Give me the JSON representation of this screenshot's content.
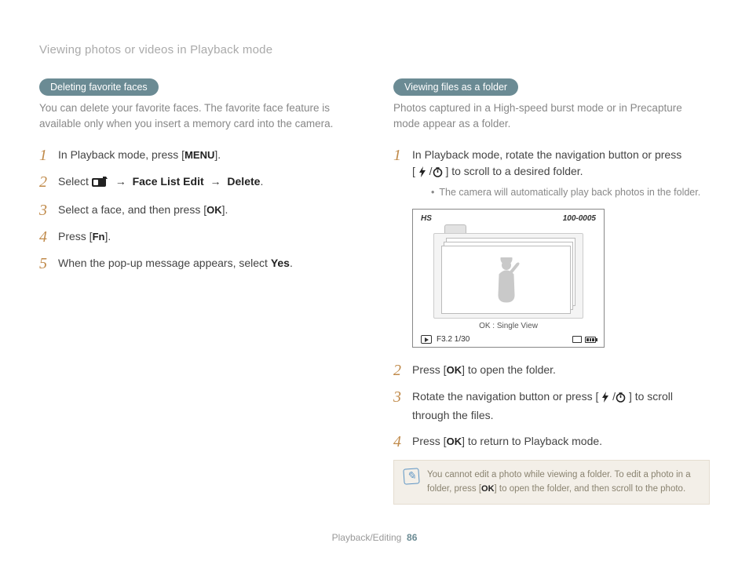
{
  "breadcrumb": "Viewing photos or videos in Playback mode",
  "left": {
    "pill": "Deleting favorite faces",
    "lead": "You can delete your favorite faces. The favorite face feature is available only when you insert a memory card into the camera.",
    "steps": [
      {
        "num": "1",
        "pre": "In Playback mode, press [",
        "btn": "MENU",
        "post": "]."
      },
      {
        "num": "2",
        "pre": "Select ",
        "path1": "Face List Edit",
        "path2": "Delete"
      },
      {
        "num": "3",
        "pre": "Select a face, and then press [",
        "btn": "OK",
        "post": "]."
      },
      {
        "num": "4",
        "pre": "Press [",
        "btn": "Fn",
        "post": "]."
      },
      {
        "num": "5",
        "pre": "When the pop-up message appears, select ",
        "bold": "Yes",
        "post": "."
      }
    ]
  },
  "right": {
    "pill": "Viewing files as a folder",
    "lead": "Photos captured in a High-speed burst mode or in Precapture mode appear as a folder.",
    "step1": {
      "num": "1",
      "line1": "In Playback mode, rotate the navigation button or press",
      "line2a": "[",
      "line2b": "] to scroll to a desired folder.",
      "sub": "The camera will automatically play back photos in the folder."
    },
    "screen": {
      "hs": "HS",
      "counter": "100-0005",
      "caption": "OK : Single View",
      "exposure": "F3.2  1/30"
    },
    "step2": {
      "num": "2",
      "pre": "Press [",
      "btn": "OK",
      "post": "] to open the folder."
    },
    "step3": {
      "num": "3",
      "pre": "Rotate the navigation button or press [",
      "post": "] to scroll through the files."
    },
    "step4": {
      "num": "4",
      "pre": "Press [",
      "btn": "OK",
      "post": "] to return to Playback mode."
    },
    "note": {
      "l1": "You cannot edit a photo while viewing a folder. To edit a photo in a folder, press [",
      "btn": "OK",
      "l2": "] to open the folder, and then scroll to the photo."
    }
  },
  "footer": {
    "section": "Playback/Editing",
    "page": "86"
  }
}
